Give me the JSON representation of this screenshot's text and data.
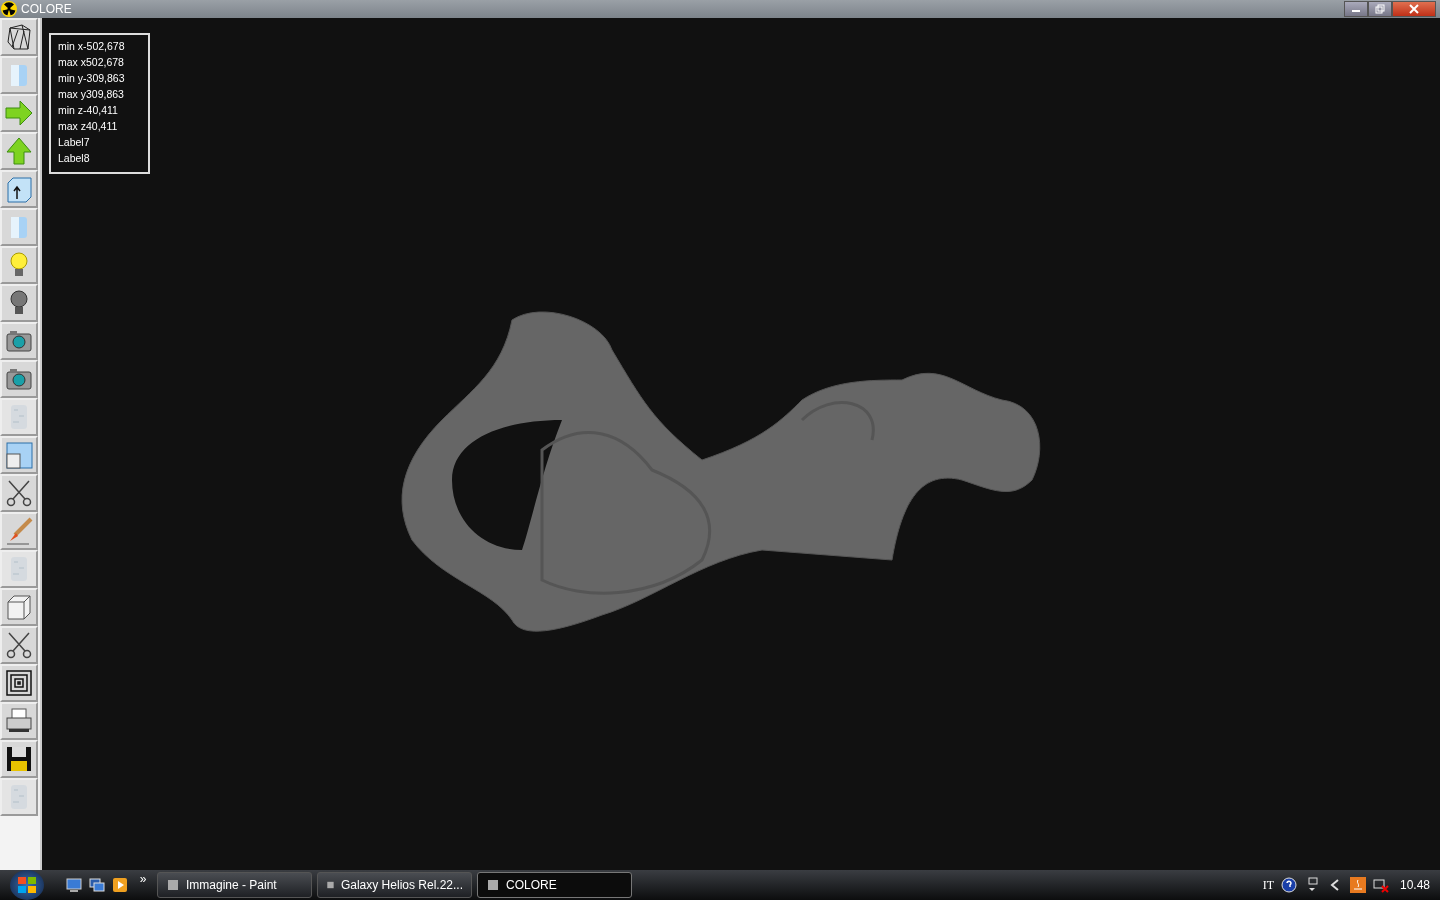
{
  "window": {
    "title": "COLORE"
  },
  "toolbar": [
    {
      "kind": "wireframe",
      "disabled": false
    },
    {
      "kind": "cylinder",
      "disabled": false
    },
    {
      "kind": "arrow-right",
      "disabled": false
    },
    {
      "kind": "arrow-up",
      "disabled": false
    },
    {
      "kind": "box-up",
      "disabled": false
    },
    {
      "kind": "cylinder",
      "disabled": false
    },
    {
      "kind": "bulb-on",
      "disabled": false
    },
    {
      "kind": "bulb-off",
      "disabled": false
    },
    {
      "kind": "camera",
      "disabled": false
    },
    {
      "kind": "camera",
      "disabled": false
    },
    {
      "kind": "texture",
      "disabled": true
    },
    {
      "kind": "windows",
      "disabled": false
    },
    {
      "kind": "scissors",
      "disabled": false
    },
    {
      "kind": "brush",
      "disabled": false
    },
    {
      "kind": "texture",
      "disabled": true
    },
    {
      "kind": "cube",
      "disabled": false
    },
    {
      "kind": "scissors",
      "disabled": false
    },
    {
      "kind": "squares",
      "disabled": false
    },
    {
      "kind": "printer",
      "disabled": false
    },
    {
      "kind": "floppy",
      "disabled": false
    },
    {
      "kind": "texture",
      "disabled": true
    }
  ],
  "info_labels": [
    "min x-502,678",
    "max x502,678",
    "min y-309,863",
    "max y309,863",
    "min z-40,411",
    "max z40,411",
    "Label7",
    "Label8"
  ],
  "taskbar": {
    "more": "»",
    "tasks": [
      {
        "label": "Immagine - Paint",
        "selected": false
      },
      {
        "label": "Galaxy Helios  Rel.22...",
        "selected": false
      },
      {
        "label": "COLORE",
        "selected": true
      }
    ],
    "language": "IT",
    "clock": "10.48"
  }
}
